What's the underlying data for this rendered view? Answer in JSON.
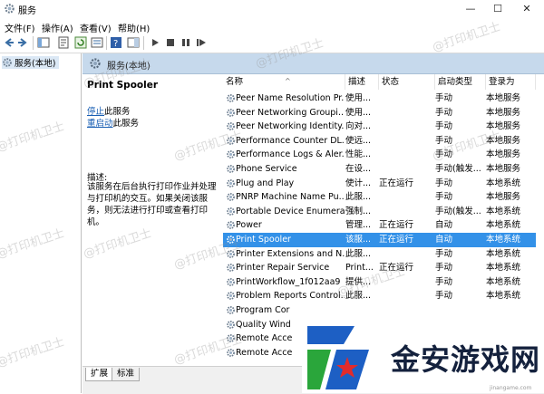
{
  "window": {
    "title": "服务"
  },
  "menu": [
    "文件(F)",
    "操作(A)",
    "查看(V)",
    "帮助(H)"
  ],
  "tree": {
    "item": "服务(本地)"
  },
  "panel": {
    "header": "服务(本地)",
    "service_name": "Print Spooler",
    "stop_link": "停止",
    "stop_suffix": "此服务",
    "restart_link": "重启动",
    "restart_suffix": "此服务",
    "desc_label": "描述:",
    "desc_text": "该服务在后台执行打印作业并处理与打印机的交互。如果关闭该服务，则无法进行打印或查看打印机。"
  },
  "list": {
    "columns": [
      "名称",
      "描述",
      "状态",
      "启动类型",
      "登录为"
    ],
    "rows": [
      {
        "name": "Peer Name Resolution Pr...",
        "desc": "使用...",
        "status": "",
        "startup": "手动",
        "logon": "本地服务"
      },
      {
        "name": "Peer Networking Groupi...",
        "desc": "使用...",
        "status": "",
        "startup": "手动",
        "logon": "本地服务"
      },
      {
        "name": "Peer Networking Identity...",
        "desc": "向对...",
        "status": "",
        "startup": "手动",
        "logon": "本地服务"
      },
      {
        "name": "Performance Counter DL...",
        "desc": "使远...",
        "status": "",
        "startup": "手动",
        "logon": "本地服务"
      },
      {
        "name": "Performance Logs & Aler...",
        "desc": "性能...",
        "status": "",
        "startup": "手动",
        "logon": "本地服务"
      },
      {
        "name": "Phone Service",
        "desc": "在设...",
        "status": "",
        "startup": "手动(触发...",
        "logon": "本地服务"
      },
      {
        "name": "Plug and Play",
        "desc": "使计...",
        "status": "正在运行",
        "startup": "手动",
        "logon": "本地系统"
      },
      {
        "name": "PNRP Machine Name Pu...",
        "desc": "此服...",
        "status": "",
        "startup": "手动",
        "logon": "本地服务"
      },
      {
        "name": "Portable Device Enumera...",
        "desc": "强制...",
        "status": "",
        "startup": "手动(触发...",
        "logon": "本地系统"
      },
      {
        "name": "Power",
        "desc": "管理...",
        "status": "正在运行",
        "startup": "自动",
        "logon": "本地系统"
      },
      {
        "name": "Print Spooler",
        "desc": "该服...",
        "status": "正在运行",
        "startup": "自动",
        "logon": "本地系统"
      },
      {
        "name": "Printer Extensions and N...",
        "desc": "此服...",
        "status": "",
        "startup": "手动",
        "logon": "本地系统"
      },
      {
        "name": "Printer Repair Service",
        "desc": "Print...",
        "status": "正在运行",
        "startup": "手动",
        "logon": "本地系统"
      },
      {
        "name": "PrintWorkflow_1f012aa9",
        "desc": "提供...",
        "status": "",
        "startup": "手动",
        "logon": "本地系统"
      },
      {
        "name": "Problem Reports Control...",
        "desc": "此服...",
        "status": "",
        "startup": "手动",
        "logon": "本地系统"
      },
      {
        "name": "Program Cor",
        "desc": "",
        "status": "",
        "startup": "",
        "logon": ""
      },
      {
        "name": "Quality Wind",
        "desc": "",
        "status": "",
        "startup": "",
        "logon": ""
      },
      {
        "name": "Remote Acce",
        "desc": "",
        "status": "",
        "startup": "",
        "logon": ""
      },
      {
        "name": "Remote Acce",
        "desc": "",
        "status": "",
        "startup": "",
        "logon": ""
      }
    ]
  },
  "tabs": [
    "扩展",
    "标准"
  ],
  "watermark": "@打印机卫士",
  "logo": {
    "text": "金安游戏网",
    "url": "jinangame.com"
  },
  "colors": {
    "selected_row": "#3391e8",
    "header_bg": "#c6d9ec",
    "link": "#1a5fb4"
  }
}
